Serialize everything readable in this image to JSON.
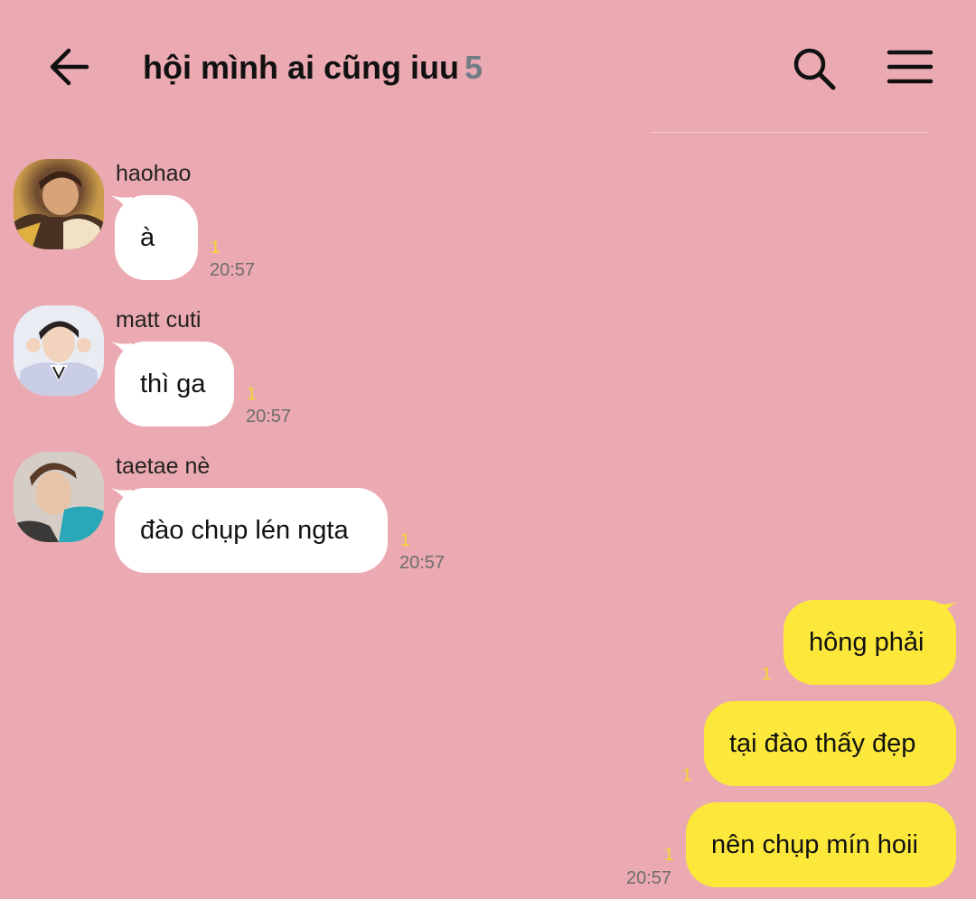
{
  "header": {
    "title": "hội mình ai cũng iuu",
    "member_count": "5"
  },
  "messages": [
    {
      "sender": "haohao",
      "text": "à",
      "unread": "1",
      "time": "20:57"
    },
    {
      "sender": "matt cuti",
      "text": "thì ga",
      "unread": "1",
      "time": "20:57"
    },
    {
      "sender": "taetae nè",
      "text": "đào chụp lén ngta",
      "unread": "1",
      "time": "20:57"
    },
    {
      "text": "hông phải",
      "unread": "1"
    },
    {
      "text": "tại đào thấy đẹp",
      "unread": "1"
    },
    {
      "text": "nên chụp mín hoii",
      "unread": "1",
      "time": "20:57"
    }
  ],
  "colors": {
    "background": "#eba9b1",
    "incoming_bubble": "#ffffff",
    "outgoing_bubble": "#fce83b",
    "unread": "#f3da2a"
  }
}
